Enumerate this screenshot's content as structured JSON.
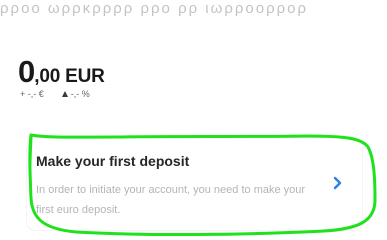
{
  "top": {
    "faded_text": "ρρoο ωρρκρρρρ ρρο ρρ ιωρροορρορ"
  },
  "account": {
    "balance_main": "0",
    "balance_rest": ",00 EUR",
    "change_amount": "+ -,- €",
    "change_percent": "-,- %"
  },
  "deposit_card": {
    "title": "Make your first deposit",
    "description": "In order to initiate your account, you need to make your first euro deposit."
  },
  "icons": {
    "trend": "triangle-up-icon",
    "action": "chevron-right-icon"
  },
  "colors": {
    "accent": "#2f7fe6",
    "annotation": "#1fe21c"
  }
}
